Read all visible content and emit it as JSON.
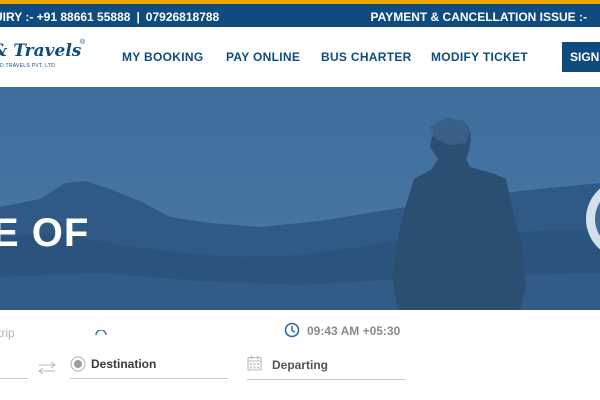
{
  "topbar": {
    "enquiry": "UIRY :- +91 88661 55888",
    "separator": "|",
    "phone2": "07926818788",
    "payment_issue": "PAYMENT & CANCELLATION ISSUE :-"
  },
  "logo": {
    "text": "& Travels",
    "reg": "®",
    "subtitle": "D TRAVELS PVT. LTD"
  },
  "nav": {
    "items": [
      "MY BOOKING",
      "PAY ONLINE",
      "BUS CHARTER",
      "MODIFY TICKET"
    ],
    "signin": "SIGN IN"
  },
  "hero": {
    "text": "E OF"
  },
  "search": {
    "trip_label": "-trip",
    "time": "09:43 AM +05:30",
    "destination_label": "Destination",
    "departing_label": "Departing"
  },
  "colors": {
    "brand": "#0e4c7f",
    "accent": "#f0a400"
  }
}
